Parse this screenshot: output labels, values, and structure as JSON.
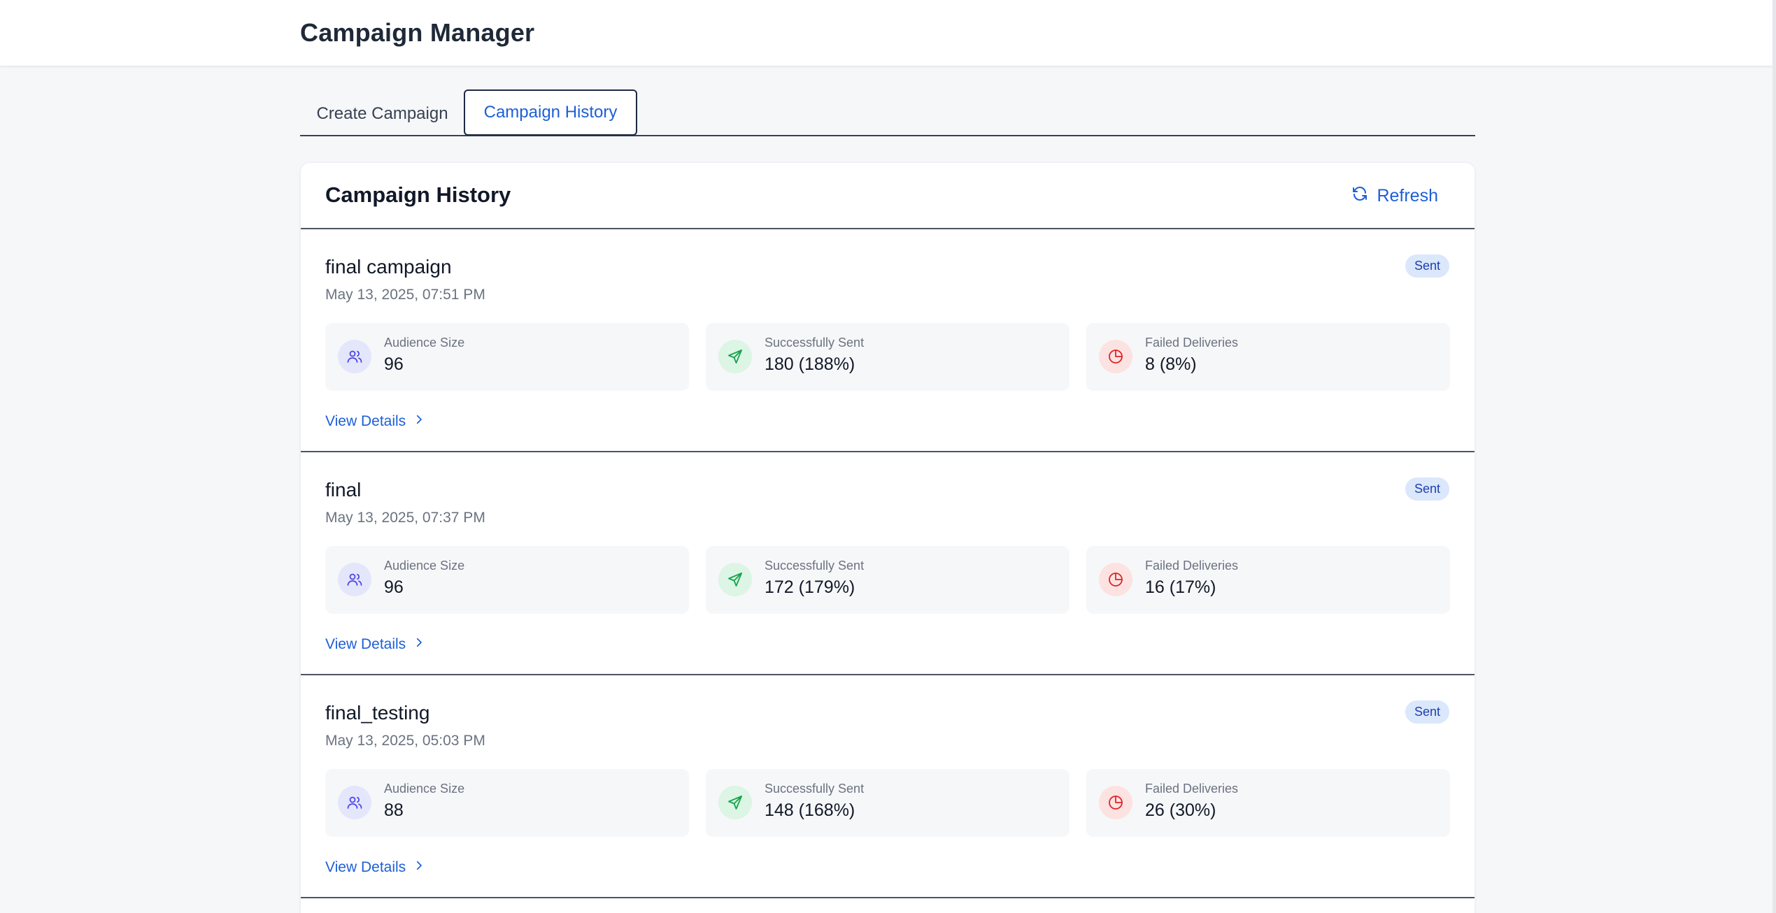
{
  "app": {
    "title": "Campaign Manager"
  },
  "tabs": [
    {
      "label": "Create Campaign",
      "active": false
    },
    {
      "label": "Campaign History",
      "active": true
    }
  ],
  "panel": {
    "title": "Campaign History",
    "refresh_label": "Refresh",
    "refresh_icon": "refresh-icon"
  },
  "stat_labels": {
    "audience": "Audience Size",
    "sent": "Successfully Sent",
    "failed": "Failed Deliveries"
  },
  "campaigns": [
    {
      "name": "final campaign",
      "date": "May 13, 2025, 07:51 PM",
      "status": "Sent",
      "audience": "96",
      "sent": "180 (188%)",
      "failed": "8 (8%)",
      "details_label": "View Details"
    },
    {
      "name": "final",
      "date": "May 13, 2025, 07:37 PM",
      "status": "Sent",
      "audience": "96",
      "sent": "172 (179%)",
      "failed": "16 (17%)",
      "details_label": "View Details"
    },
    {
      "name": "final_testing",
      "date": "May 13, 2025, 05:03 PM",
      "status": "Sent",
      "audience": "88",
      "sent": "148 (168%)",
      "failed": "26 (30%)",
      "details_label": "View Details"
    }
  ],
  "colors": {
    "accent": "#1d5fd6",
    "badge_bg": "#dbe7fb",
    "users_icon": "#4f46e5",
    "sent_icon": "#16a34a",
    "failed_icon": "#dc2626"
  }
}
